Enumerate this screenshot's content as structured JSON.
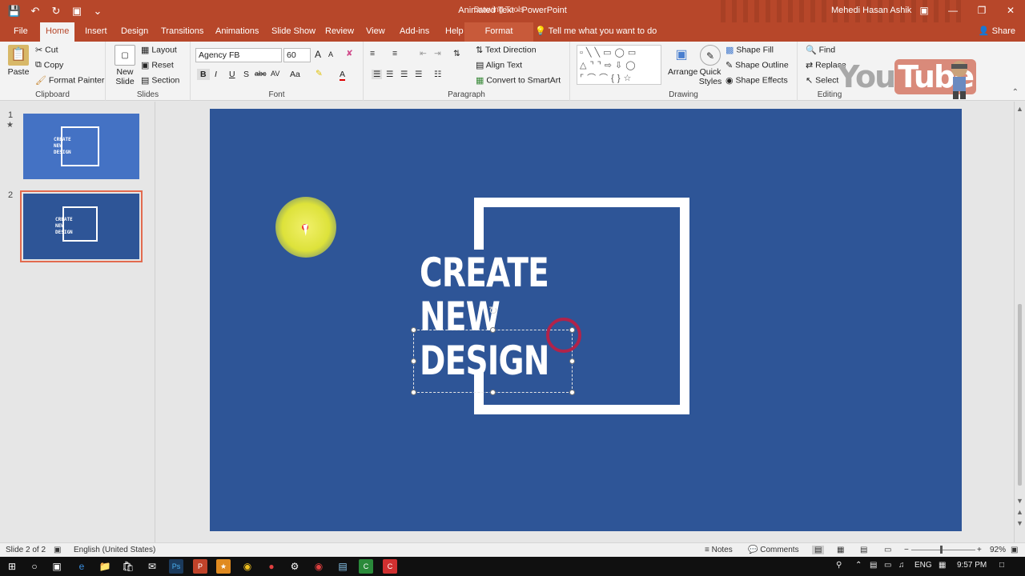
{
  "titlebar": {
    "quick_access": [
      "save-icon",
      "undo-icon",
      "redo-icon",
      "presentation-icon",
      "customize-icon"
    ],
    "document_title": "Animated Text  -  PowerPoint",
    "context_title": "Drawing Tools",
    "user": "Mehedi Hasan Ashik",
    "window_controls": [
      "ribbon-display-icon",
      "minimize-icon",
      "restore-icon",
      "close-icon"
    ]
  },
  "tabs": {
    "items": [
      "File",
      "Home",
      "Insert",
      "Design",
      "Transitions",
      "Animations",
      "Slide Show",
      "Review",
      "View",
      "Add-ins",
      "Help",
      "Format"
    ],
    "active": "Home",
    "tellme": "Tell me what you want to do",
    "share": "Share"
  },
  "ribbon": {
    "clipboard": {
      "label": "Clipboard",
      "paste": "Paste",
      "cut": "Cut",
      "copy": "Copy",
      "format_painter": "Format Painter"
    },
    "slides": {
      "label": "Slides",
      "new_slide": "New",
      "new_slide_2": "Slide",
      "layout": "Layout",
      "reset": "Reset",
      "section": "Section"
    },
    "font": {
      "label": "Font",
      "family": "Agency FB",
      "size": "60",
      "bold": "B",
      "italic": "I",
      "underline": "U",
      "shadow": "S",
      "strike": "abc",
      "spacing": "AV",
      "case": "Aa",
      "color": "A",
      "grow": "A",
      "shrink": "A"
    },
    "paragraph": {
      "label": "Paragraph",
      "text_direction": "Text Direction",
      "align_text": "Align Text",
      "smartart": "Convert to SmartArt"
    },
    "drawing": {
      "label": "Drawing",
      "arrange": "Arrange",
      "quick": "Quick",
      "styles": "Styles",
      "shape_fill": "Shape Fill",
      "shape_outline": "Shape Outline",
      "shape_effects": "Shape Effects"
    },
    "editing": {
      "label": "Editing",
      "find": "Find",
      "replace": "Replace",
      "select": "Select"
    }
  },
  "watermark": {
    "you": "You",
    "tube": "Tube"
  },
  "thumbnails": [
    {
      "number": "1",
      "star": "★",
      "lines": [
        "CREATE",
        "NEW",
        "DESIGN"
      ],
      "selected": false
    },
    {
      "number": "2",
      "star": "",
      "lines": [
        "CREATE",
        "NEW",
        "DESIGN"
      ],
      "selected": true
    }
  ],
  "slide": {
    "background": "#2e5597",
    "lines": [
      "CREATE",
      "NEW",
      "DESIGN"
    ]
  },
  "status": {
    "slide_info": "Slide 2 of 2",
    "language": "English (United States)",
    "notes": "Notes",
    "comments": "Comments",
    "zoom": "92%"
  },
  "taskbar": {
    "apps": [
      "start-icon",
      "cortana-icon",
      "taskview-icon",
      "edge-icon",
      "explorer-icon",
      "store-icon",
      "mail-icon",
      "photoshop-icon",
      "powerpoint-icon",
      "illustrator-icon",
      "chrome-icon",
      "recorder-icon",
      "settings-icon",
      "app-icon",
      "notepad-icon",
      "camtasia-icon",
      "app2-icon"
    ],
    "lang": "ENG",
    "time": "9:57 PM"
  },
  "colors": {
    "accent": "#b7472a",
    "slide": "#2e5597",
    "highlight": "#dde23a",
    "click_ring": "#b1234a"
  }
}
